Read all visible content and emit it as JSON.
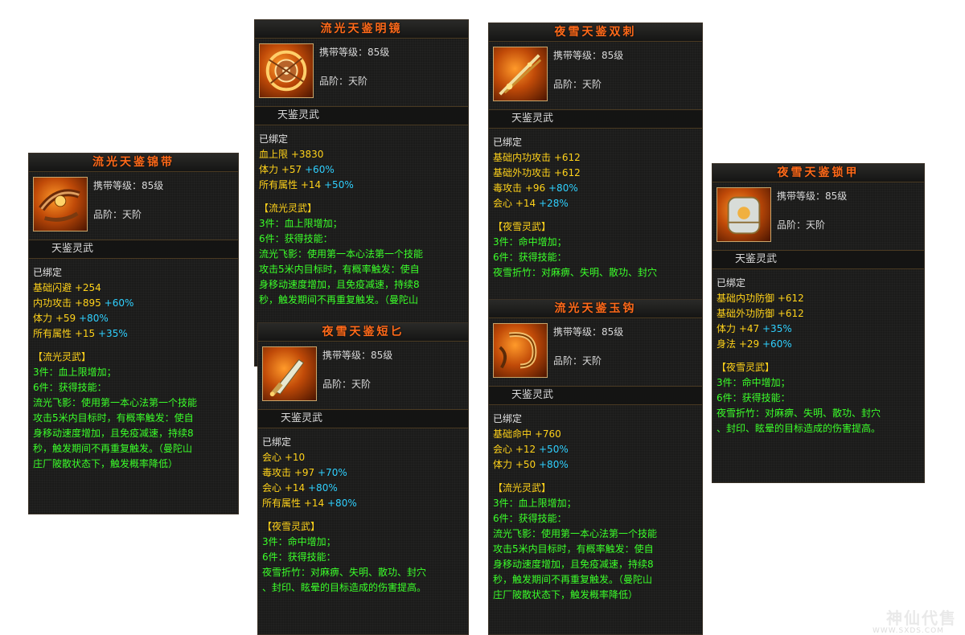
{
  "common": {
    "level": "携带等级：85级",
    "grade": "品阶：天阶",
    "category": "天鉴灵武",
    "bound": "已绑定"
  },
  "cards": {
    "jindai": {
      "title": "流光天鉴锦带",
      "icon": "belt-icon",
      "stats": [
        {
          "name": "基础闪避",
          "flat": "+254",
          "pct": ""
        },
        {
          "name": "内功攻击",
          "flat": "+895",
          "pct": "+60%"
        },
        {
          "name": "体力",
          "flat": "+59",
          "pct": "+80%"
        },
        {
          "name": "所有属性",
          "flat": "+15",
          "pct": "+35%"
        }
      ],
      "set_name": "【流光灵武】",
      "set_lines": [
        "3件：血上限增加；",
        "6件：获得技能：",
        "流光飞影：使用第一本心法第一个技能",
        "攻击5米内目标时，有概率触发：使自",
        "身移动速度增加，且免疫减速，持续8",
        "秒，触发期间不再重复触发。（曼陀山",
        "庄厂陂散状态下，触发概率降低）"
      ]
    },
    "mingjing": {
      "title": "流光天鉴明镜",
      "icon": "mirror-icon",
      "stats": [
        {
          "name": "血上限",
          "flat": "+3830",
          "pct": ""
        },
        {
          "name": "体力",
          "flat": "+57",
          "pct": "+60%"
        },
        {
          "name": "所有属性",
          "flat": "+14",
          "pct": "+50%"
        }
      ],
      "set_name": "【流光灵武】",
      "set_lines": [
        "3件：血上限增加；",
        "6件：获得技能：",
        "流光飞影：使用第一本心法第一个技能",
        "攻击5米内目标时，有概率触发：使自",
        "身移动速度增加，且免疫减速，持续8",
        "秒，触发期间不再重复触发。（曼陀山"
      ]
    },
    "duanbi": {
      "title": "夜雪天鉴短匕",
      "icon": "dagger-icon",
      "stats": [
        {
          "name": "会心",
          "flat": "+10",
          "pct": ""
        },
        {
          "name": "毒攻击",
          "flat": "+97",
          "pct": "+70%"
        },
        {
          "name": "会心",
          "flat": "+14",
          "pct": "+80%"
        },
        {
          "name": "所有属性",
          "flat": "+14",
          "pct": "+80%"
        }
      ],
      "set_name": "【夜雪灵武】",
      "set_lines": [
        "3件：命中增加；",
        "6件：获得技能：",
        "夜雪折竹：对麻痹、失明、散功、封穴",
        "、封印、眩晕的目标造成的伤害提高。"
      ]
    },
    "shuangci": {
      "title": "夜雪天鉴双刺",
      "icon": "twin-blade-icon",
      "stats": [
        {
          "name": "基础内功攻击",
          "flat": "+612",
          "pct": ""
        },
        {
          "name": "基础外功攻击",
          "flat": "+612",
          "pct": ""
        },
        {
          "name": "毒攻击",
          "flat": "+96",
          "pct": "+80%"
        },
        {
          "name": "会心",
          "flat": "+14",
          "pct": "+28%"
        }
      ],
      "set_name": "【夜雪灵武】",
      "set_lines": [
        "3件：命中增加；",
        "6件：获得技能：",
        "夜雪折竹：对麻痹、失明、散功、封穴"
      ]
    },
    "yugou": {
      "title": "流光天鉴玉钩",
      "icon": "hook-icon",
      "stats": [
        {
          "name": "基础命中",
          "flat": "+760",
          "pct": ""
        },
        {
          "name": "会心",
          "flat": "+12",
          "pct": "+50%"
        },
        {
          "name": "体力",
          "flat": "+50",
          "pct": "+80%"
        }
      ],
      "set_name": "【流光灵武】",
      "set_lines": [
        "3件：血上限增加；",
        "6件：获得技能：",
        "流光飞影：使用第一本心法第一个技能",
        "攻击5米内目标时，有概率触发：使自",
        "身移动速度增加，且免疫减速，持续8",
        "秒，触发期间不再重复触发。（曼陀山",
        "庄厂陂散状态下，触发概率降低）"
      ]
    },
    "suojia": {
      "title": "夜雪天鉴锁甲",
      "icon": "armor-icon",
      "stats": [
        {
          "name": "基础内功防御",
          "flat": "+612",
          "pct": ""
        },
        {
          "name": "基础外功防御",
          "flat": "+612",
          "pct": ""
        },
        {
          "name": "体力",
          "flat": "+47",
          "pct": "+35%"
        },
        {
          "name": "身法",
          "flat": "+29",
          "pct": "+60%"
        }
      ],
      "set_name": "【夜雪灵武】",
      "set_lines": [
        "3件：命中增加；",
        "6件：获得技能：",
        "夜雪折竹：对麻痹、失明、散功、封穴",
        "、封印、眩晕的目标造成的伤害提高。"
      ]
    }
  },
  "watermark": {
    "text": "神仙代售",
    "url": "WWW.SXDS.COM"
  },
  "colors": {
    "title": "#ff6a1a",
    "stat": "#ffd21a",
    "pct": "#2fd0ff",
    "set": "#3bff2a"
  }
}
